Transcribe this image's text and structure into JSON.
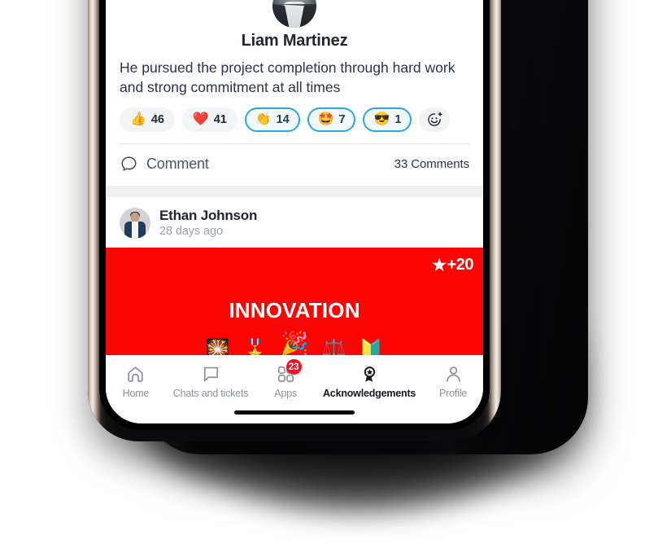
{
  "posts": [
    {
      "author": "Liam Martinez",
      "message": "He pursued the project completion through hard work and strong commitment at all times",
      "reactions": [
        {
          "name": "thumbs-up",
          "emoji": "👍",
          "count": "46",
          "selected": false
        },
        {
          "name": "heart",
          "emoji": "❤️",
          "count": "41",
          "selected": false
        },
        {
          "name": "clap",
          "emoji": "👏",
          "count": "14",
          "selected": true
        },
        {
          "name": "star-struck",
          "emoji": "🤩",
          "count": "7",
          "selected": true
        },
        {
          "name": "sunglasses",
          "emoji": "😎",
          "count": "1",
          "selected": true
        }
      ],
      "add_reaction_label": "Add reaction",
      "comment_label": "Comment",
      "comment_count": "33 Comments"
    },
    {
      "author": "Ethan Johnson",
      "timestamp": "28 days ago",
      "banner": {
        "title": "INNOVATION",
        "points": "+20",
        "star_glyph": "★",
        "color": "#fb0404",
        "decorations": [
          "🎇",
          "🎖️",
          "🎉",
          "⚖️",
          "🔰"
        ]
      }
    }
  ],
  "bottom_nav": {
    "items": [
      {
        "label": "Home",
        "icon": "home-icon",
        "active": false,
        "badge": null
      },
      {
        "label": "Chats and tickets",
        "icon": "chat-bubble-icon",
        "active": false,
        "badge": null
      },
      {
        "label": "Apps",
        "icon": "apps-grid-icon",
        "active": false,
        "badge": "23"
      },
      {
        "label": "Acknowledgements",
        "icon": "award-badge-icon",
        "active": true,
        "badge": null
      },
      {
        "label": "Profile",
        "icon": "person-icon",
        "active": false,
        "badge": null
      }
    ]
  },
  "colors": {
    "accent_red": "#fb0404",
    "badge_red": "#ef1122",
    "selected_pill_border": "#2aa7e0",
    "nav_inactive": "#8b909a",
    "nav_active": "#15181f"
  }
}
